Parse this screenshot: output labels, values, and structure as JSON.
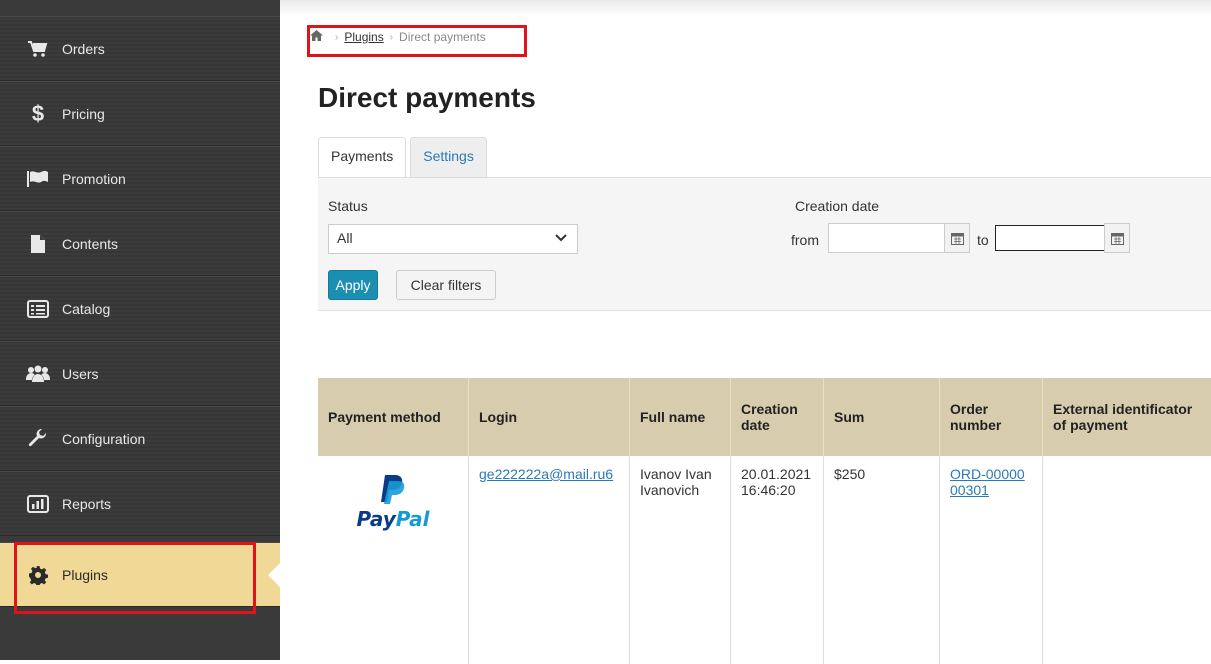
{
  "sidebar": {
    "items": [
      {
        "label": "Orders",
        "icon": "cart-icon"
      },
      {
        "label": "Pricing",
        "icon": "dollar-icon"
      },
      {
        "label": "Promotion",
        "icon": "flag-icon"
      },
      {
        "label": "Contents",
        "icon": "document-icon"
      },
      {
        "label": "Catalog",
        "icon": "list-icon"
      },
      {
        "label": "Users",
        "icon": "users-icon"
      },
      {
        "label": "Configuration",
        "icon": "wrench-icon"
      },
      {
        "label": "Reports",
        "icon": "bar-chart-icon"
      },
      {
        "label": "Plugins",
        "icon": "gear-icon",
        "active": true
      }
    ]
  },
  "breadcrumb": {
    "home_icon": "home-icon",
    "level1": "Plugins",
    "current": "Direct payments"
  },
  "page": {
    "title": "Direct payments"
  },
  "tabs": [
    {
      "label": "Payments",
      "active": true
    },
    {
      "label": "Settings",
      "active": false
    }
  ],
  "filters": {
    "status_label": "Status",
    "status_value": "All",
    "creation_date_label": "Creation date",
    "from_label": "from",
    "to_label": "to",
    "apply_label": "Apply",
    "clear_label": "Clear filters"
  },
  "table": {
    "headers": [
      "Payment method",
      "Login",
      "Full name",
      "Creation date",
      "Sum",
      "Order number",
      "External identificator of payment"
    ],
    "rows": [
      {
        "payment_method_logo": "PayPal",
        "login": "ge222222a@mail.ru6",
        "full_name": "Ivanov Ivan Ivanovich",
        "creation_date": "20.01.2021 16:46:20",
        "sum": "$250",
        "order_number": "ORD-0000000301",
        "external_id": ""
      }
    ]
  },
  "colors": {
    "sidebar_bg": "#3a3a3a",
    "active_item_bg": "#f0d896",
    "highlight_red": "#e0131b",
    "header_bg": "#d7ccae",
    "apply_button": "#1a8fb2",
    "link": "#2a7ab8"
  }
}
